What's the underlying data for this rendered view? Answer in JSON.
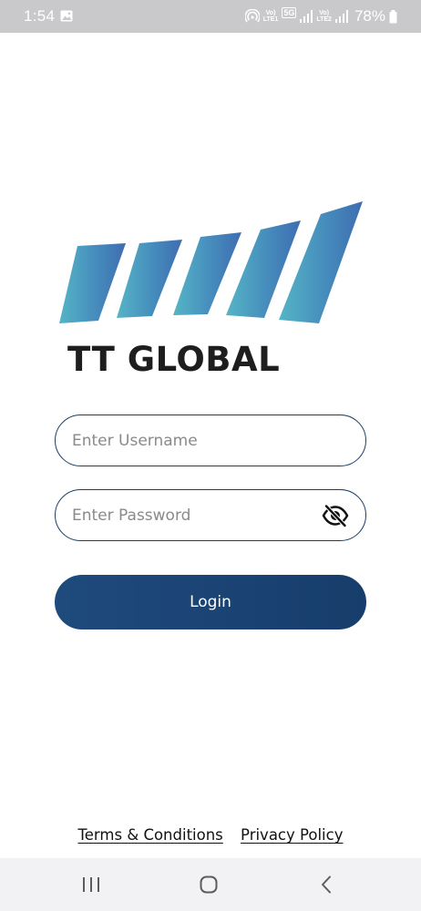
{
  "status_bar": {
    "time": "1:54",
    "battery": "78%",
    "sim1_label_top": "Vo)",
    "sim1_label_bottom": "LTE1",
    "network_badge": "5G",
    "sim2_label_top": "Vo)",
    "sim2_label_bottom": "LTE2",
    "icons": [
      "gallery-icon",
      "hotspot-icon",
      "signal-icon",
      "battery-icon"
    ]
  },
  "brand": {
    "name": "TT GLOBAL",
    "logo_colors": [
      "#52b3c4",
      "#4a9bbf",
      "#4585ba",
      "#3f6fb0"
    ]
  },
  "form": {
    "username_placeholder": "Enter Username",
    "password_placeholder": "Enter Password",
    "password_visibility_icon": "eye-off-icon",
    "login_label": "Login",
    "field_border_color": "#1c3d64",
    "button_color": "#1a4270"
  },
  "footer": {
    "terms_label": "Terms & Conditions",
    "privacy_label": "Privacy Policy"
  },
  "nav": {
    "icons": [
      "recents-icon",
      "home-icon",
      "back-icon"
    ]
  }
}
